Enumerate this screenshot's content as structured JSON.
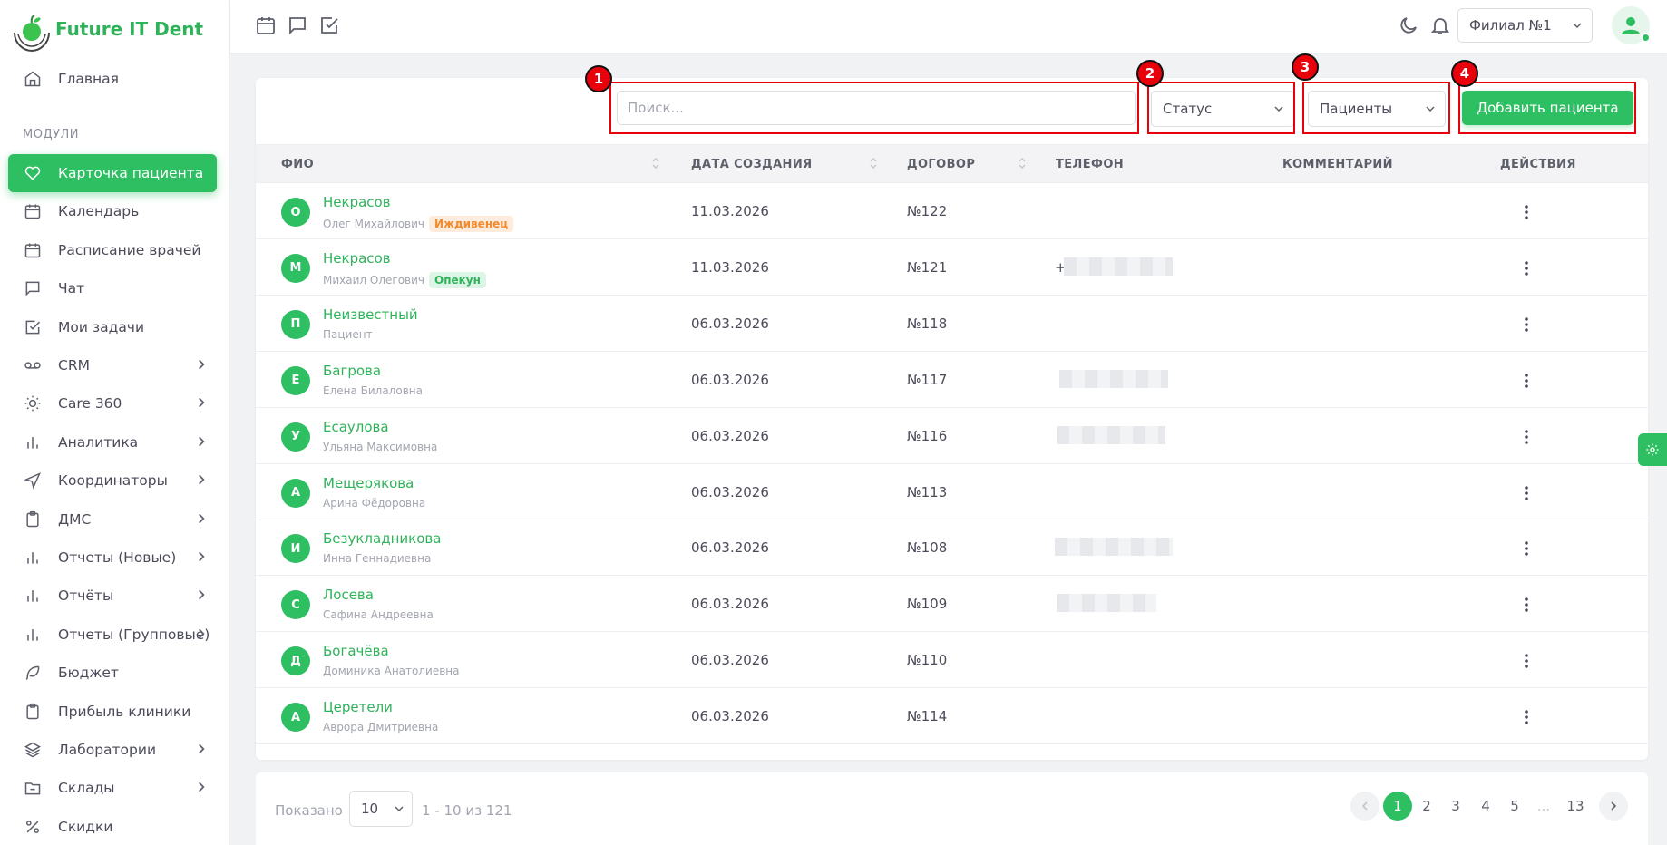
{
  "app": {
    "name": "Future IT Dent"
  },
  "sidebar": {
    "home": "Главная",
    "section": "МОДУЛИ",
    "items": [
      {
        "label": "Карточка пациента",
        "icon": "heart-icon",
        "active": true
      },
      {
        "label": "Календарь",
        "icon": "calendar-icon"
      },
      {
        "label": "Расписание врачей",
        "icon": "calendar-icon"
      },
      {
        "label": "Чат",
        "icon": "chat-icon"
      },
      {
        "label": "Мои задачи",
        "icon": "checkbox-icon"
      },
      {
        "label": "CRM",
        "icon": "voicemail-icon",
        "expandable": true
      },
      {
        "label": "Care 360",
        "icon": "sun-icon",
        "expandable": true
      },
      {
        "label": "Аналитика",
        "icon": "bar-chart-icon",
        "expandable": true
      },
      {
        "label": "Координаторы",
        "icon": "send-icon",
        "expandable": true
      },
      {
        "label": "ДМС",
        "icon": "clipboard-icon",
        "expandable": true
      },
      {
        "label": "Отчеты (Новые)",
        "icon": "bar-chart-icon",
        "expandable": true
      },
      {
        "label": "Отчёты",
        "icon": "bar-chart-icon",
        "expandable": true
      },
      {
        "label": "Отчеты (Групповые)",
        "icon": "bar-chart-icon",
        "expandable": true
      },
      {
        "label": "Бюджет",
        "icon": "feather-icon"
      },
      {
        "label": "Прибыль клиники",
        "icon": "clipboard-icon"
      },
      {
        "label": "Лаборатории",
        "icon": "layers-icon",
        "expandable": true
      },
      {
        "label": "Склады",
        "icon": "folder-icon",
        "expandable": true
      },
      {
        "label": "Скидки",
        "icon": "percent-icon"
      }
    ]
  },
  "topbar": {
    "branch": "Филиал №1"
  },
  "toolbar": {
    "search_placeholder": "Поиск...",
    "status_label": "Статус",
    "type_label": "Пациенты",
    "add_button": "Добавить пациента",
    "markers": [
      "1",
      "2",
      "3",
      "4"
    ]
  },
  "table": {
    "columns": [
      "ФИО",
      "ДАТА СОЗДАНИЯ",
      "ДОГОВОР",
      "ТЕЛЕФОН",
      "КОММЕНТАРИЙ",
      "ДЕЙСТВИЯ"
    ],
    "rows": [
      {
        "initial": "О",
        "surname": "Некрасов",
        "name": "Олег Михайлович",
        "badge": "Иждивенец",
        "badge_color": "orange",
        "date": "11.03.2026",
        "contract": "№122",
        "phone": ""
      },
      {
        "initial": "М",
        "surname": "Некрасов",
        "name": "Михаил Олегович",
        "badge": "Опекун",
        "badge_color": "green",
        "date": "11.03.2026",
        "contract": "№121",
        "phone": "+"
      },
      {
        "initial": "П",
        "surname": "Неизвестный",
        "name": "Пациент",
        "badge": "",
        "date": "06.03.2026",
        "contract": "№118",
        "phone": ""
      },
      {
        "initial": "Е",
        "surname": "Багрова",
        "name": "Елена Билаловна",
        "badge": "",
        "date": "06.03.2026",
        "contract": "№117",
        "phone": ""
      },
      {
        "initial": "У",
        "surname": "Есаулова",
        "name": "Ульяна Максимовна",
        "badge": "",
        "date": "06.03.2026",
        "contract": "№116",
        "phone": ""
      },
      {
        "initial": "А",
        "surname": "Мещерякова",
        "name": "Арина Фёдоровна",
        "badge": "",
        "date": "06.03.2026",
        "contract": "№113",
        "phone": ""
      },
      {
        "initial": "И",
        "surname": "Безукладникова",
        "name": "Инна Геннадиевна",
        "badge": "",
        "date": "06.03.2026",
        "contract": "№108",
        "phone": ""
      },
      {
        "initial": "С",
        "surname": "Лосева",
        "name": "Сафина Андреевна",
        "badge": "",
        "date": "06.03.2026",
        "contract": "№109",
        "phone": ""
      },
      {
        "initial": "Д",
        "surname": "Богачёва",
        "name": "Доминика Анатолиевна",
        "badge": "",
        "date": "06.03.2026",
        "contract": "№110",
        "phone": ""
      },
      {
        "initial": "А",
        "surname": "Церетели",
        "name": "Аврора Дмитриевна",
        "badge": "",
        "date": "06.03.2026",
        "contract": "№114",
        "phone": ""
      }
    ]
  },
  "pagination": {
    "shown_label": "Показано",
    "page_size": "10",
    "range": "1 - 10 из 121",
    "pages": [
      "1",
      "2",
      "3",
      "4",
      "5",
      "...",
      "13"
    ],
    "current": "1"
  },
  "colors": {
    "accent": "#2fbf63",
    "highlight": "#e8000b"
  }
}
